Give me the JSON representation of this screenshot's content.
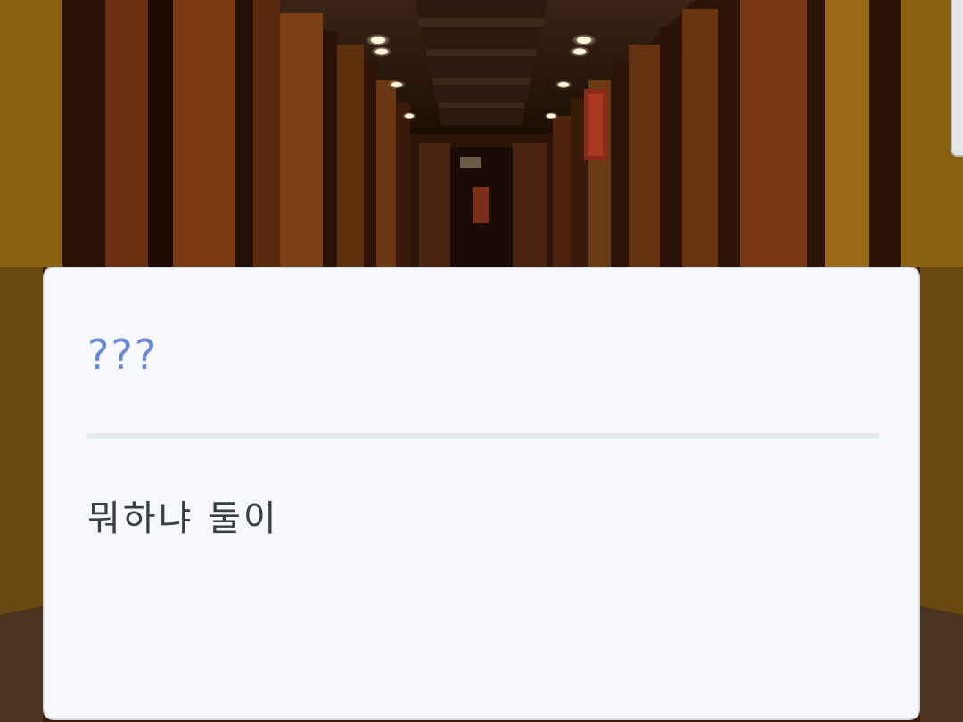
{
  "dialog": {
    "speaker": "???",
    "message": "뭐하냐 둘이"
  },
  "colors": {
    "speaker_text": "#6b87d8",
    "message_text": "#3a3d44",
    "dialog_bg": "#f6f8fb"
  }
}
